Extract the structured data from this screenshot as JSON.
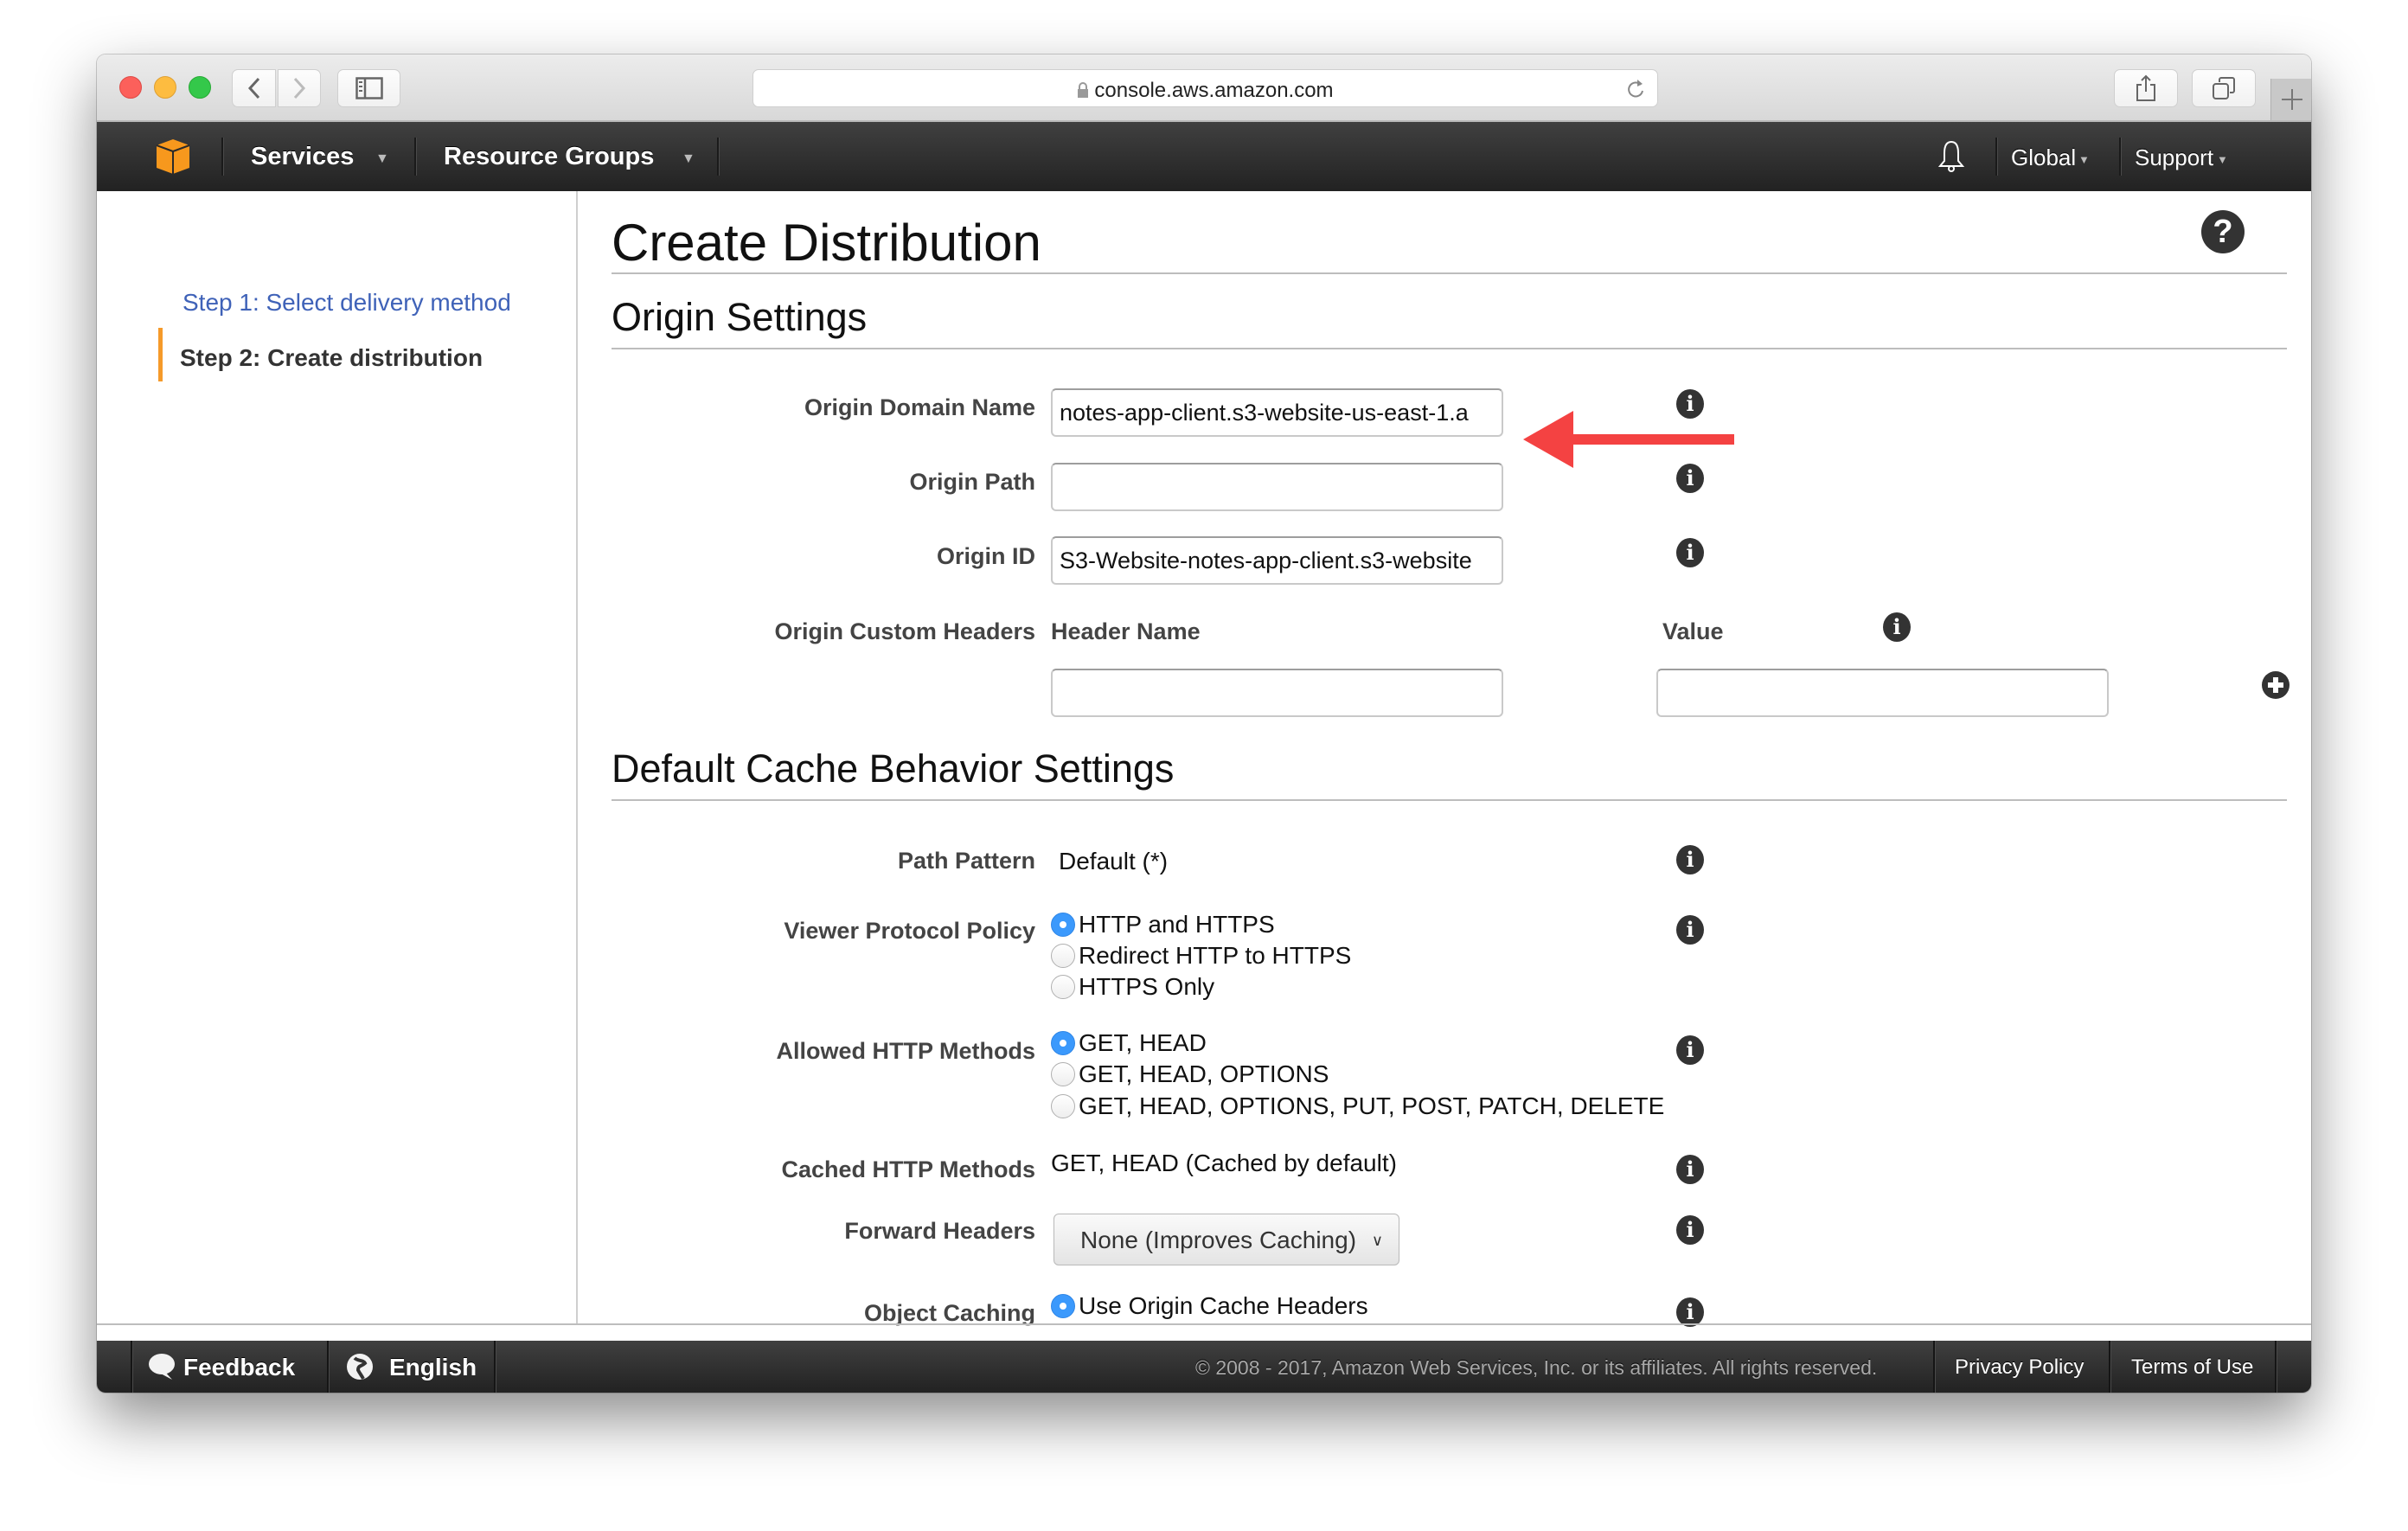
{
  "browser": {
    "url": "console.aws.amazon.com",
    "traffic_lights": {
      "close": "#fc605b",
      "minimize": "#fdbc40",
      "zoom": "#34c84a"
    }
  },
  "nav": {
    "logo_icon": "aws-cube-icon",
    "services": "Services",
    "resource_groups": "Resource Groups",
    "region": "Global",
    "support": "Support",
    "bell_icon": "bell-icon"
  },
  "sidebar": {
    "steps": [
      {
        "label": "Step 1: Select delivery method",
        "active": false
      },
      {
        "label": "Step 2: Create distribution",
        "active": true
      }
    ]
  },
  "main": {
    "title": "Create Distribution",
    "origin_settings": {
      "heading": "Origin Settings",
      "origin_domain_name": {
        "label": "Origin Domain Name",
        "value": "notes-app-client.s3-website-us-east-1.a"
      },
      "origin_path": {
        "label": "Origin Path",
        "value": ""
      },
      "origin_id": {
        "label": "Origin ID",
        "value": "S3-Website-notes-app-client.s3-website"
      },
      "custom_headers": {
        "label": "Origin Custom Headers",
        "header_name_label": "Header Name",
        "value_label": "Value",
        "header_name_value": "",
        "value_value": ""
      }
    },
    "cache_behavior": {
      "heading": "Default Cache Behavior Settings",
      "path_pattern": {
        "label": "Path Pattern",
        "value": "Default (*)"
      },
      "viewer_protocol_policy": {
        "label": "Viewer Protocol Policy",
        "options": [
          {
            "label": "HTTP and HTTPS",
            "selected": true
          },
          {
            "label": "Redirect HTTP to HTTPS",
            "selected": false
          },
          {
            "label": "HTTPS Only",
            "selected": false
          }
        ]
      },
      "allowed_http_methods": {
        "label": "Allowed HTTP Methods",
        "options": [
          {
            "label": "GET, HEAD",
            "selected": true
          },
          {
            "label": "GET, HEAD, OPTIONS",
            "selected": false
          },
          {
            "label": "GET, HEAD, OPTIONS, PUT, POST, PATCH, DELETE",
            "selected": false
          }
        ]
      },
      "cached_http_methods": {
        "label": "Cached HTTP Methods",
        "value": "GET, HEAD (Cached by default)"
      },
      "forward_headers": {
        "label": "Forward Headers",
        "selected": "None (Improves Caching)"
      },
      "object_caching": {
        "label": "Object Caching",
        "options": [
          {
            "label": "Use Origin Cache Headers",
            "selected": true
          }
        ]
      }
    },
    "annotation": {
      "type": "red-arrow",
      "color": "#f44242",
      "points_to": "origin_domain_name"
    }
  },
  "footer": {
    "feedback": "Feedback",
    "language": "English",
    "copyright": "© 2008 - 2017, Amazon Web Services, Inc. or its affiliates. All rights reserved.",
    "privacy": "Privacy Policy",
    "terms": "Terms of Use"
  }
}
